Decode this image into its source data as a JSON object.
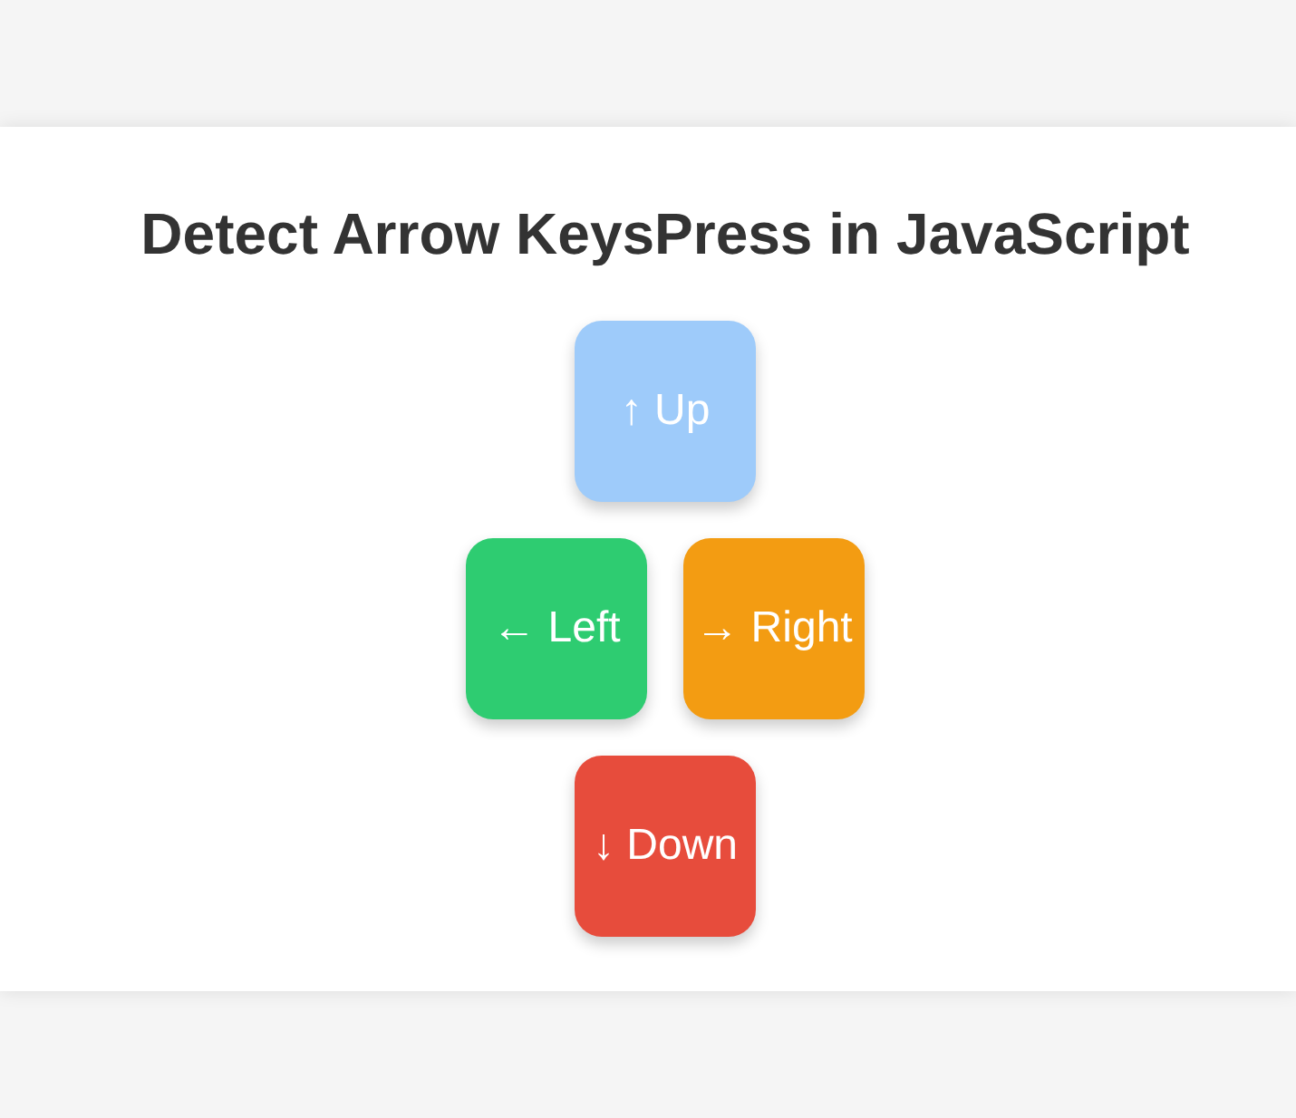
{
  "title": "Detect Arrow KeysPress in JavaScript",
  "keypad": {
    "rows": [
      [
        {
          "label": "↑ Up",
          "color": "#9ecbfa"
        }
      ],
      [
        {
          "label": "← Left",
          "color": "#2ecc71"
        },
        {
          "label": "→ Right",
          "color": "#f39c12"
        }
      ],
      [
        {
          "label": "↓ Down",
          "color": "#e74c3c"
        }
      ]
    ]
  }
}
